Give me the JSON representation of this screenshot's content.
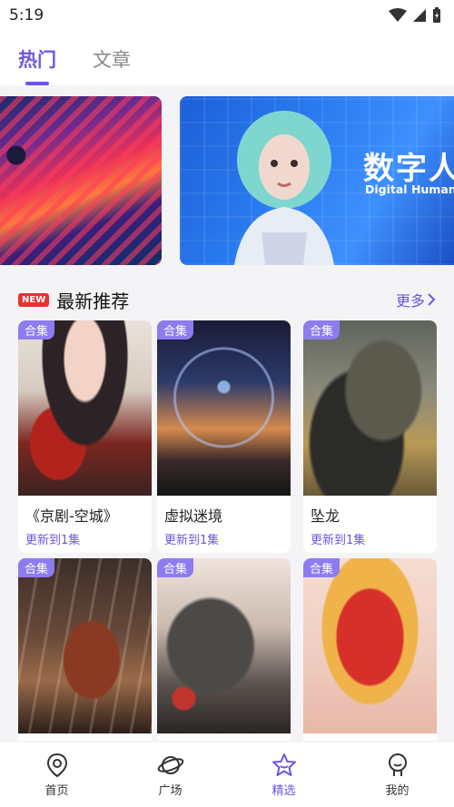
{
  "status": {
    "time": "5:19"
  },
  "tabs": [
    {
      "label": "热门",
      "active": true
    },
    {
      "label": "文章",
      "active": false
    }
  ],
  "banner": {
    "title": "数字人",
    "subtitle": "Digital Human"
  },
  "section": {
    "badge": "NEW",
    "title": "最新推荐",
    "more": "更多"
  },
  "cards": [
    {
      "tag": "合集",
      "title": "《京剧-空城》",
      "subtitle": "更新到1集"
    },
    {
      "tag": "合集",
      "title": "虚拟迷境",
      "subtitle": "更新到1集"
    },
    {
      "tag": "合集",
      "title": "坠龙",
      "subtitle": "更新到1集"
    },
    {
      "tag": "合集"
    },
    {
      "tag": "合集"
    },
    {
      "tag": "合集"
    }
  ],
  "nav": [
    {
      "label": "首页",
      "icon": "home-icon"
    },
    {
      "label": "广场",
      "icon": "planet-icon"
    },
    {
      "label": "精选",
      "icon": "star-icon",
      "active": true
    },
    {
      "label": "我的",
      "icon": "profile-icon"
    }
  ],
  "colors": {
    "accent": "#6a57e0",
    "badge": "#e8312f",
    "tag": "#8d7cf0"
  }
}
